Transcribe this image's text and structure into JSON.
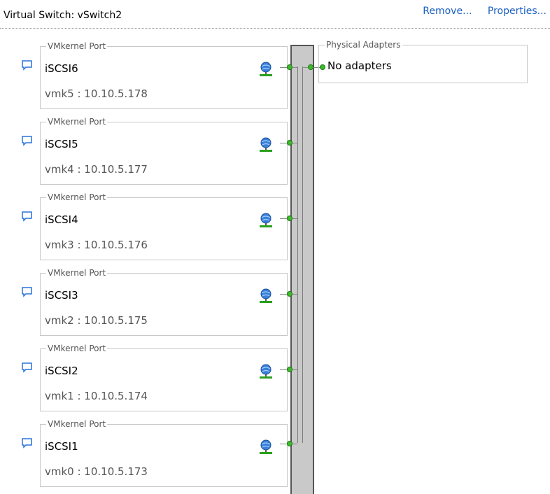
{
  "header": {
    "title": "Virtual Switch: vSwitch2",
    "remove_label": "Remove...",
    "properties_label": "Properties..."
  },
  "ports": [
    {
      "type": "VMkernel Port",
      "name": "iSCSI6",
      "vmk": "vmk5 : 10.10.5.178"
    },
    {
      "type": "VMkernel Port",
      "name": "iSCSI5",
      "vmk": "vmk4 : 10.10.5.177"
    },
    {
      "type": "VMkernel Port",
      "name": "iSCSI4",
      "vmk": "vmk3 : 10.10.5.176"
    },
    {
      "type": "VMkernel Port",
      "name": "iSCSI3",
      "vmk": "vmk2 : 10.10.5.175"
    },
    {
      "type": "VMkernel Port",
      "name": "iSCSI2",
      "vmk": "vmk1 : 10.10.5.174"
    },
    {
      "type": "VMkernel Port",
      "name": "iSCSI1",
      "vmk": "vmk0 : 10.10.5.173"
    }
  ],
  "physical_adapters": {
    "legend": "Physical Adapters",
    "status": "No adapters"
  },
  "colors": {
    "link": "#1a5fc4",
    "connector": "#3dbb2c",
    "switch": "#c9c9c9"
  },
  "icons": {
    "port": "speech-bubble-icon",
    "vmkernel": "globe-network-icon"
  }
}
